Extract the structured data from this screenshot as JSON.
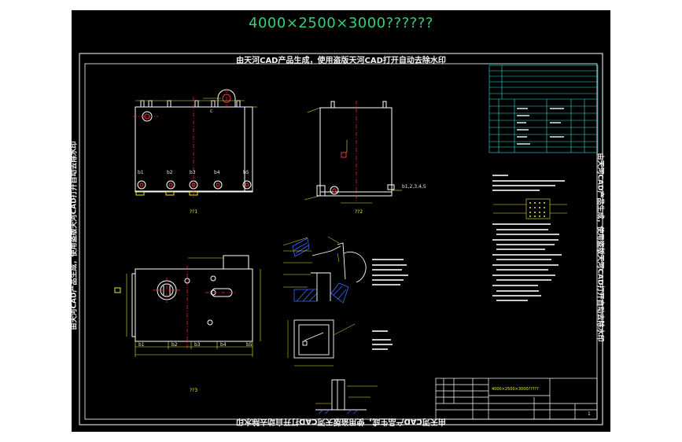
{
  "drawing": {
    "title": "4000×2500×3000??????",
    "banner": "由天河CAD产品生成，使用盗版天河CAD打开自动去除水印"
  },
  "views": {
    "front_label": "??1",
    "side_label": "??2",
    "top_label": "??3",
    "nozzles": [
      "b1",
      "b2",
      "b3",
      "b4",
      "b5"
    ],
    "side_nozzles": "b1,2,3,4,5",
    "nozzle_c": "c"
  },
  "title_block": {
    "drawing_name": "4000×2500×3000?????",
    "sheet": "1"
  },
  "colors": {
    "background": "#000000",
    "title": "#33d07a",
    "outline": "#ffffff",
    "centerline": "#ff3030",
    "dimension": "#e8e832",
    "hatch": "#3a6cff",
    "table": "#2de0e0"
  }
}
